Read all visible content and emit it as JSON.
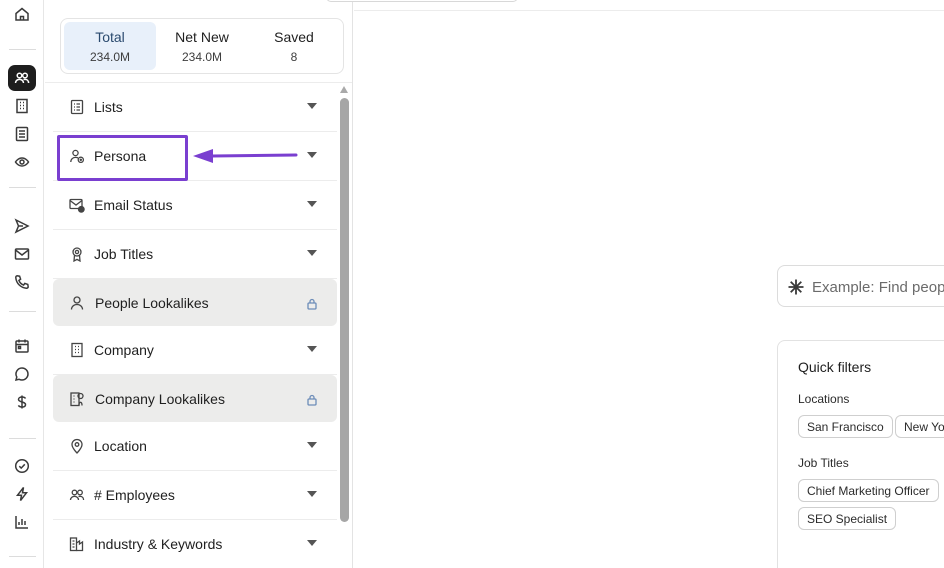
{
  "rail": {
    "icons": [
      "home-icon",
      "people-icon",
      "building-icon",
      "list-icon",
      "eye-refresh-icon",
      "send-icon",
      "mail-icon",
      "phone-icon",
      "calendar-icon",
      "chat-icon",
      "dollar-icon",
      "check-circle-icon",
      "bolt-icon",
      "chart-icon"
    ],
    "active": "people-icon"
  },
  "tabs": [
    {
      "label": "Total",
      "value": "234.0M"
    },
    {
      "label": "Net New",
      "value": "234.0M"
    },
    {
      "label": "Saved",
      "value": "8"
    }
  ],
  "filters": [
    {
      "label": "Lists",
      "icon": "list-icon",
      "locked": false
    },
    {
      "label": "Persona",
      "icon": "persona-icon",
      "locked": false
    },
    {
      "label": "Email Status",
      "icon": "email-status-icon",
      "locked": false
    },
    {
      "label": "Job Titles",
      "icon": "badge-icon",
      "locked": false
    },
    {
      "label": "People Lookalikes",
      "icon": "person-icon",
      "locked": true
    },
    {
      "label": "Company",
      "icon": "building-icon",
      "locked": false
    },
    {
      "label": "Company Lookalikes",
      "icon": "company-lookalike-icon",
      "locked": true
    },
    {
      "label": "Location",
      "icon": "location-pin-icon",
      "locked": false
    },
    {
      "label": "# Employees",
      "icon": "group-icon",
      "locked": false
    },
    {
      "label": "Industry & Keywords",
      "icon": "industry-icon",
      "locked": false
    }
  ],
  "annotation": {
    "color": "#7a3fd0",
    "target": "Persona"
  },
  "search": {
    "placeholder": "Example: Find people"
  },
  "quick_filters": {
    "title": "Quick filters",
    "locations_label": "Locations",
    "locations": [
      "San Francisco",
      "New York"
    ],
    "job_titles_label": "Job Titles",
    "job_titles": [
      "Chief Marketing Officer",
      "SEO Specialist"
    ]
  }
}
